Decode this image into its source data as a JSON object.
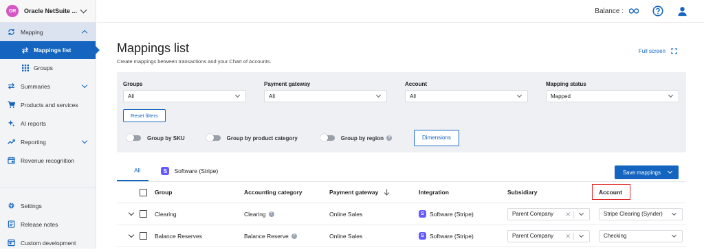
{
  "org": {
    "initials": "OR",
    "name": "Oracle NetSuite ..."
  },
  "sidebar": {
    "items": [
      {
        "label": "Mapping"
      },
      {
        "label": "Mappings list"
      },
      {
        "label": "Groups"
      },
      {
        "label": "Summaries"
      },
      {
        "label": "Products and services"
      },
      {
        "label": "AI reports"
      },
      {
        "label": "Reporting"
      },
      {
        "label": "Revenue recognition"
      }
    ],
    "bottom": [
      {
        "label": "Settings"
      },
      {
        "label": "Release notes"
      },
      {
        "label": "Custom development"
      }
    ]
  },
  "topbar": {
    "balance_label": "Balance :"
  },
  "page": {
    "title": "Mappings list",
    "subtitle": "Create mappings between transactions and your Chart of Accounts.",
    "fullscreen": "Full screen"
  },
  "filters": {
    "groups": {
      "label": "Groups",
      "value": "All"
    },
    "gateway": {
      "label": "Payment gateway",
      "value": "All"
    },
    "account": {
      "label": "Account",
      "value": "All"
    },
    "status": {
      "label": "Mapping status",
      "value": "Mapped"
    },
    "reset": "Reset filters",
    "toggles": [
      "Group by SKU",
      "Group by product category",
      "Group by region"
    ],
    "dimensions": "Dimensions"
  },
  "tabs": {
    "all": "All",
    "stripe": "Software (Stripe)",
    "stripe_icon": "S",
    "save": "Save mappings"
  },
  "table": {
    "headers": {
      "group": "Group",
      "category": "Accounting category",
      "gateway": "Payment gateway",
      "integration": "Integration",
      "subsidiary": "Subsidiary",
      "account": "Account"
    },
    "rows": [
      {
        "group": "Clearing",
        "category": "Clearing",
        "gateway": "Online Sales",
        "integration": "Software (Stripe)",
        "subsidiary": "Parent Company",
        "account": "Stripe Clearing (Synder)"
      },
      {
        "group": "Balance Reserves",
        "category": "Balance Reserve",
        "gateway": "Online Sales",
        "integration": "Software (Stripe)",
        "subsidiary": "Parent Company",
        "account": "Checking"
      }
    ]
  },
  "colors": {
    "accent": "#1565c0",
    "stripe": "#635bff",
    "highlight": "#e02020"
  }
}
